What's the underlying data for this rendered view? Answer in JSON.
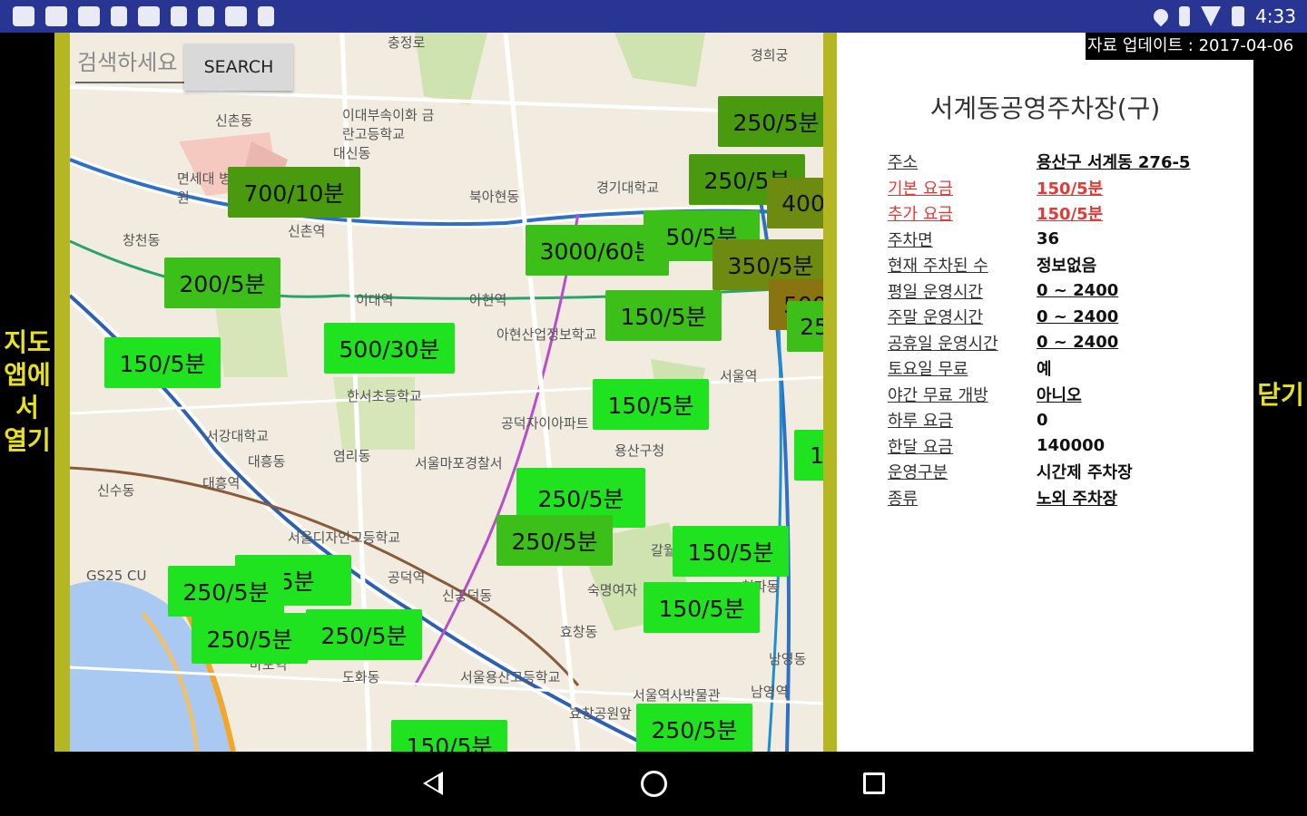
{
  "status_bar": {
    "time": "4:33",
    "left_icons": [
      "app-icon",
      "youtube-icon",
      "youtube-icon",
      "app-icon",
      "radio-icon",
      "circle-icon",
      "phone-icon",
      "photo-icon",
      "android-icon"
    ],
    "right_icons": [
      "location-icon",
      "bluetooth-icon",
      "wifi-icon",
      "battery-icon"
    ]
  },
  "side": {
    "open_in_map": "지도\n앱에\n서\n열기",
    "close": "닫기"
  },
  "search": {
    "placeholder": "검색하세요",
    "button": "SEARCH"
  },
  "map_labels": [
    "신촌동",
    "이대부속이화 금란고등학교",
    "대신동",
    "면세대 병원",
    "신촌역",
    "북아현동",
    "경기대학교",
    "창천동",
    "이대역",
    "아현역",
    "아현산업정보학교",
    "서울역",
    "한서초등학교",
    "공덕자이아파트",
    "서강대학교",
    "대흥동",
    "염리동",
    "서울마포경찰서",
    "대흥역",
    "신수동",
    "서울디자인고등학교",
    "공덕역",
    "숙명여자",
    "신공덕동",
    "용산구청",
    "GS25 CU",
    "효창동",
    "마포역",
    "도화동",
    "서울용산고등학교",
    "효창공원앞",
    "남영역",
    "서울역사박물관",
    "충정로",
    "경희궁",
    "남영동",
    "갈월동",
    "청파동"
  ],
  "markers": [
    {
      "label": "250/5분",
      "tone": "dark"
    },
    {
      "label": "250/5분",
      "tone": "dark"
    },
    {
      "label": "400",
      "tone": "olive"
    },
    {
      "label": "700/10분",
      "tone": "dark"
    },
    {
      "label": "3000/60분",
      "tone": "mid"
    },
    {
      "label": "50/5분",
      "tone": "mid"
    },
    {
      "label": "350/5분",
      "tone": "olive"
    },
    {
      "label": "200/5분",
      "tone": "mid"
    },
    {
      "label": "500",
      "tone": "brown"
    },
    {
      "label": "25",
      "tone": "mid"
    },
    {
      "label": "150/5분",
      "tone": "mid"
    },
    {
      "label": "500/30분",
      "tone": "green"
    },
    {
      "label": "150/5분",
      "tone": "green"
    },
    {
      "label": "150/5분",
      "tone": "green"
    },
    {
      "label": "1",
      "tone": "green"
    },
    {
      "label": "250/5분",
      "tone": "green"
    },
    {
      "label": "250/5분",
      "tone": "mid"
    },
    {
      "label": "150/5분",
      "tone": "green"
    },
    {
      "label": "/5분",
      "tone": "green"
    },
    {
      "label": "250/5분",
      "tone": "green"
    },
    {
      "label": "150/5분",
      "tone": "green"
    },
    {
      "label": "250/5분",
      "tone": "green"
    },
    {
      "label": "250/5분",
      "tone": "green"
    },
    {
      "label": "150/5분",
      "tone": "green"
    },
    {
      "label": "250/5분",
      "tone": "green"
    }
  ],
  "panel": {
    "update_banner": "자료 업데이트 : 2017-04-06",
    "title": "서계동공영주차장(구)",
    "rows": [
      {
        "key": "주소",
        "value": "용산구 서계동 276-5",
        "highlight": false
      },
      {
        "key": "기본 요금",
        "value": "150/5분",
        "highlight": true
      },
      {
        "key": "추가 요금",
        "value": "150/5분",
        "highlight": true
      },
      {
        "key": "주차면",
        "value": "36",
        "highlight": false
      },
      {
        "key": "현재 주차된 수",
        "value": "정보없음",
        "highlight": false
      },
      {
        "key": "평일 운영시간",
        "value": "0 ~ 2400",
        "highlight": false
      },
      {
        "key": "주말 운영시간",
        "value": "0 ~ 2400",
        "highlight": false
      },
      {
        "key": "공휴일 운영시간",
        "value": "0 ~ 2400",
        "highlight": false
      },
      {
        "key": "토요일 무료",
        "value": "예",
        "highlight": false
      },
      {
        "key": "야간 무료 개방",
        "value": "아니오",
        "highlight": false
      },
      {
        "key": "하루 요금",
        "value": "0",
        "highlight": false
      },
      {
        "key": "한달 요금",
        "value": "140000",
        "highlight": false
      },
      {
        "key": "운영구분",
        "value": "시간제 주차장",
        "highlight": false
      },
      {
        "key": "종류",
        "value": "노외 주차장",
        "highlight": false
      }
    ]
  }
}
